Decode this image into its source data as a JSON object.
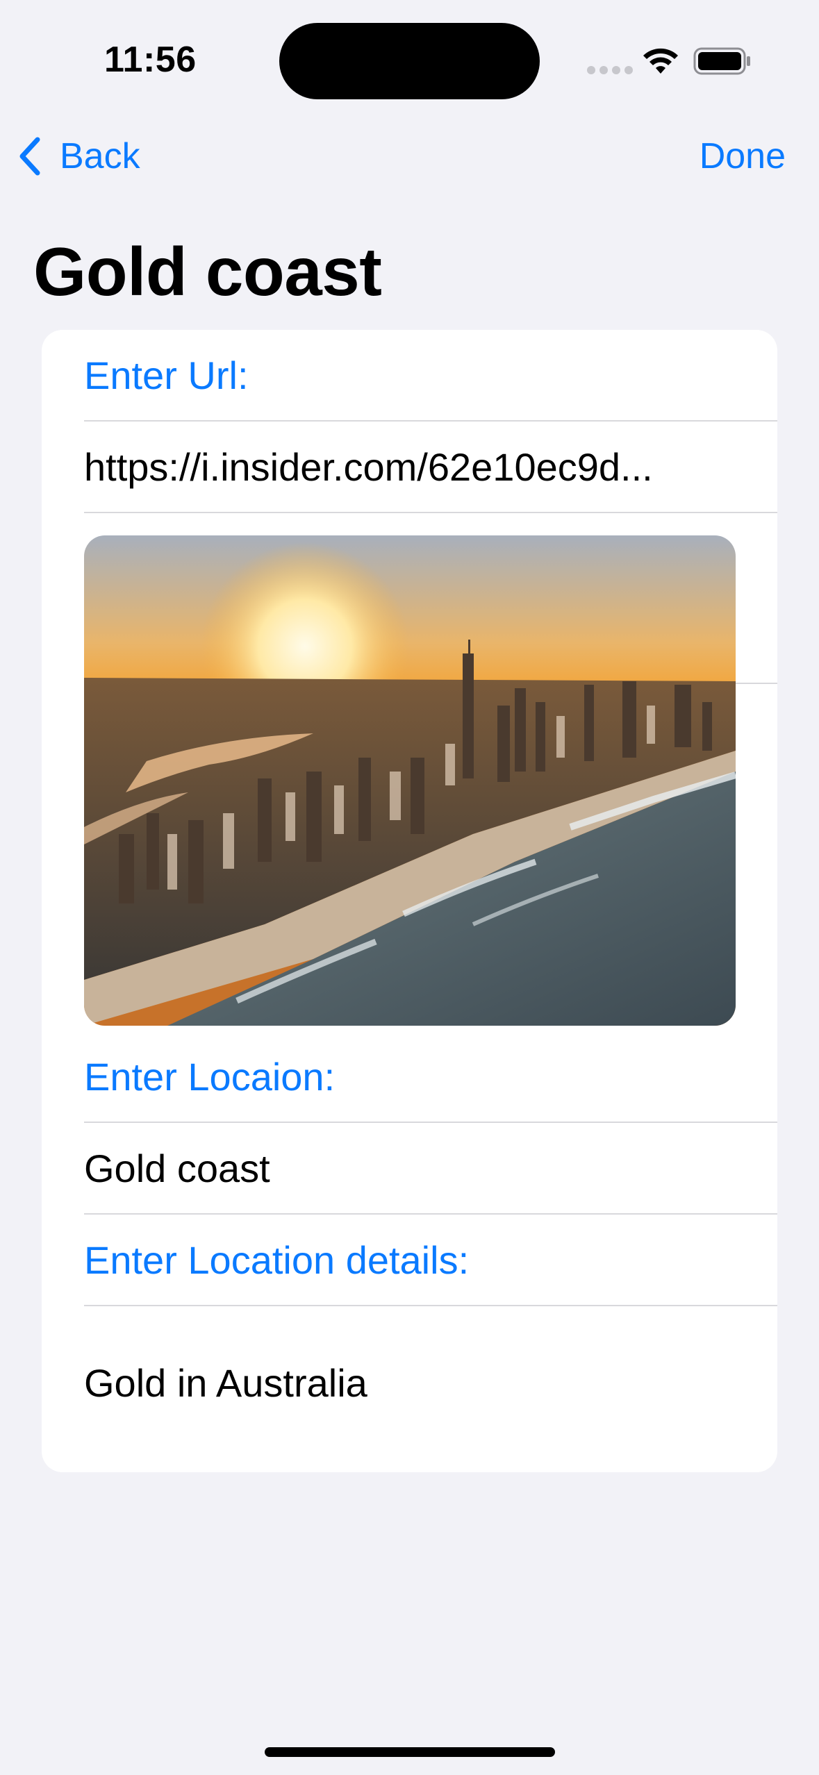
{
  "status_bar": {
    "time": "11:56"
  },
  "nav": {
    "back_label": "Back",
    "done_label": "Done"
  },
  "page": {
    "title": "Gold coast"
  },
  "form": {
    "url_label": "Enter Url:",
    "url_value": "https://i.insider.com/62e10ec9d...",
    "location_label": "Enter Locaion:",
    "location_value": "Gold coast",
    "details_label": "Enter Location details:",
    "details_value": "Gold in Australia"
  },
  "colors": {
    "accent": "#0a7aff",
    "background": "#f2f2f7",
    "card": "#ffffff",
    "separator": "#d8d8dc"
  },
  "icons": {
    "back": "chevron-left-icon",
    "wifi": "wifi-icon",
    "battery": "battery-icon",
    "cellular": "cellular-signal-icon"
  }
}
